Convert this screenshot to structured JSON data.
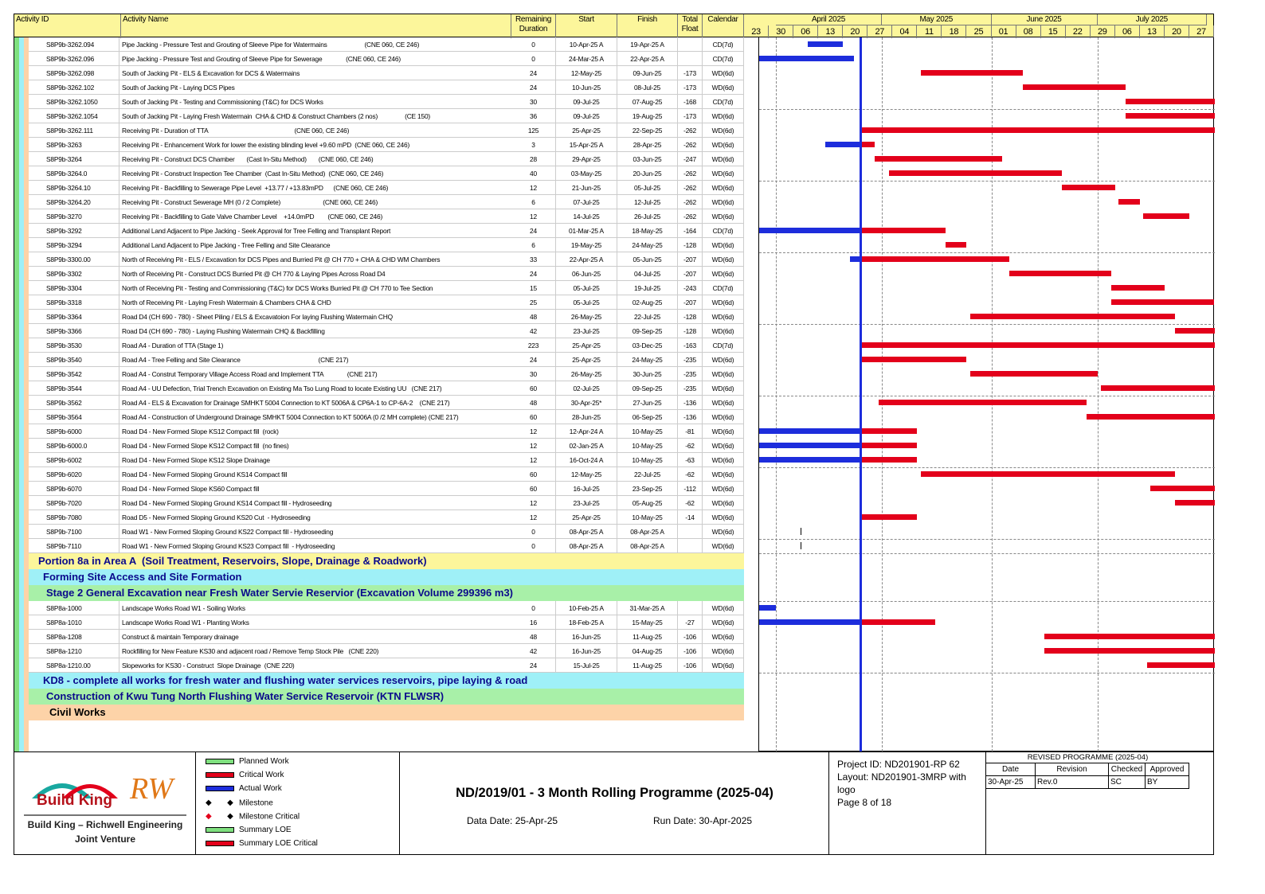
{
  "colors": {
    "planned": "#7fe07f",
    "critical": "#e3001b",
    "actual": "#1d2ddc",
    "header": "#fcf69b"
  },
  "columns": {
    "id": "Activity ID",
    "name": "Activity Name",
    "dur": "Remaining Duration",
    "start": "Start",
    "finish": "Finish",
    "float": "Total Float",
    "cal": "Calendar"
  },
  "timeline": {
    "months": [
      "April 2025",
      "May 2025",
      "June 2025",
      "July 2025"
    ],
    "weeks": [
      "23",
      "30",
      "06",
      "13",
      "20",
      "27",
      "04",
      "11",
      "18",
      "25",
      "01",
      "08",
      "15",
      "22",
      "29",
      "06",
      "13",
      "20",
      "27"
    ],
    "data_date_label": "Data Date"
  },
  "rows": [
    {
      "id": "S8P9b-3262.094",
      "name": "Pipe Jacking - Pressure Test and Grouting of Sleeve Pipe for Watermains                      (CNE 060, CE 246)",
      "dur": "0",
      "start": "10-Apr-25 A",
      "finish": "19-Apr-25 A",
      "float": "",
      "cal": "CD(7d)",
      "bars": [
        {
          "t": "actual",
          "s": "2025-04-10",
          "f": "2025-04-19"
        }
      ]
    },
    {
      "id": "S8P9b-3262.096",
      "name": "Pipe Jacking - Pressure Test and Grouting of Sleeve Pipe for Sewerage              (CNE 060, CE 246)",
      "dur": "0",
      "start": "24-Mar-25 A",
      "finish": "22-Apr-25 A",
      "float": "",
      "cal": "CD(7d)",
      "bars": [
        {
          "t": "actual",
          "s": "2025-03-24",
          "f": "2025-04-22"
        }
      ]
    },
    {
      "id": "S8P9b-3262.098",
      "name": "South of Jacking Pit - ELS & Excavation for DCS & Watermains",
      "dur": "24",
      "start": "12-May-25",
      "finish": "09-Jun-25",
      "float": "-173",
      "cal": "WD(6d)",
      "bars": [
        {
          "t": "critical",
          "s": "2025-05-12",
          "f": "2025-06-09"
        }
      ]
    },
    {
      "id": "S8P9b-3262.102",
      "name": "South of Jacking Pit - Laying DCS Pipes",
      "dur": "24",
      "start": "10-Jun-25",
      "finish": "08-Jul-25",
      "float": "-173",
      "cal": "WD(6d)",
      "bars": [
        {
          "t": "critical",
          "s": "2025-06-10",
          "f": "2025-07-08"
        }
      ]
    },
    {
      "id": "S8P9b-3262.1050",
      "name": "South of Jacking Pit - Testing and Commissioning (T&C) for DCS Works",
      "dur": "30",
      "start": "09-Jul-25",
      "finish": "07-Aug-25",
      "float": "-168",
      "cal": "CD(7d)",
      "bars": [
        {
          "t": "critical",
          "s": "2025-07-09",
          "f": "2025-08-07"
        }
      ]
    },
    {
      "id": "S8P9b-3262.1054",
      "name": "South of Jacking Pit - Laying Fresh Watermain  CHA & CHD & Construct Chambers (2 nos)                (CE 150)",
      "dur": "36",
      "start": "09-Jul-25",
      "finish": "19-Aug-25",
      "float": "-173",
      "cal": "WD(6d)",
      "bars": [
        {
          "t": "critical",
          "s": "2025-07-09",
          "f": "2025-08-19"
        }
      ]
    },
    {
      "id": "S8P9b-3262.111",
      "name": "Receiving Pit - Duration of TTA                                                   (CNE 060, CE 246)",
      "dur": "125",
      "start": "25-Apr-25",
      "finish": "22-Sep-25",
      "float": "-262",
      "cal": "WD(6d)",
      "bars": [
        {
          "t": "critical",
          "s": "2025-04-25",
          "f": "2025-09-22"
        }
      ]
    },
    {
      "id": "S8P9b-3263",
      "name": "Receiving Pit - Enhancement Work for lower the existing blinding level +9.60 mPD  (CNE 060, CE 246)",
      "dur": "3",
      "start": "15-Apr-25 A",
      "finish": "28-Apr-25",
      "float": "-262",
      "cal": "WD(6d)",
      "bars": [
        {
          "t": "actual",
          "s": "2025-04-15",
          "f": "2025-04-25"
        },
        {
          "t": "critical",
          "s": "2025-04-25",
          "f": "2025-04-28"
        }
      ]
    },
    {
      "id": "S8P9b-3264",
      "name": "Receiving Pit - Construct DCS Chamber       (Cast In-Situ Method)       (CNE 060, CE 246)",
      "dur": "28",
      "start": "29-Apr-25",
      "finish": "03-Jun-25",
      "float": "-247",
      "cal": "WD(6d)",
      "bars": [
        {
          "t": "critical",
          "s": "2025-04-29",
          "f": "2025-06-03"
        }
      ]
    },
    {
      "id": "S8P9b-3264.0",
      "name": "Receiving Pit - Construct Inspection Tee Chamber  (Cast In-Situ Method)  (CNE 060, CE 246)",
      "dur": "40",
      "start": "03-May-25",
      "finish": "20-Jun-25",
      "float": "-262",
      "cal": "WD(6d)",
      "bars": [
        {
          "t": "critical",
          "s": "2025-05-03",
          "f": "2025-06-20"
        }
      ]
    },
    {
      "id": "S8P9b-3264.10",
      "name": "Receiving Pit - Backfilling to Sewerage Pipe Level  +13.77 / +13.83mPD      (CNE 060, CE 246)",
      "dur": "12",
      "start": "21-Jun-25",
      "finish": "05-Jul-25",
      "float": "-262",
      "cal": "WD(6d)",
      "bars": [
        {
          "t": "critical",
          "s": "2025-06-21",
          "f": "2025-07-05"
        }
      ]
    },
    {
      "id": "S8P9b-3264.20",
      "name": "Receiving Pit - Construct Sewerage MH (0 / 2 Complete)                         (CNE 060, CE 246)",
      "dur": "6",
      "start": "07-Jul-25",
      "finish": "12-Jul-25",
      "float": "-262",
      "cal": "WD(6d)",
      "bars": [
        {
          "t": "critical",
          "s": "2025-07-07",
          "f": "2025-07-12"
        }
      ]
    },
    {
      "id": "S8P9b-3270",
      "name": "Receiving Pit - Backfilling to Gate Valve Chamber Level    +14.0mPD        (CNE 060, CE 246)",
      "dur": "12",
      "start": "14-Jul-25",
      "finish": "26-Jul-25",
      "float": "-262",
      "cal": "WD(6d)",
      "bars": [
        {
          "t": "critical",
          "s": "2025-07-14",
          "f": "2025-07-26"
        }
      ]
    },
    {
      "id": "S8P9b-3292",
      "name": "Additional Land Adjacent to Pipe Jacking - Seek Approval for Tree Felling and Transplant Report",
      "dur": "24",
      "start": "01-Mar-25 A",
      "finish": "18-May-25",
      "float": "-164",
      "cal": "CD(7d)",
      "bars": [
        {
          "t": "actual",
          "s": "2025-03-01",
          "f": "2025-04-25"
        },
        {
          "t": "critical",
          "s": "2025-04-25",
          "f": "2025-05-18"
        }
      ]
    },
    {
      "id": "S8P9b-3294",
      "name": "Additional Land Adjacent to Pipe Jacking - Tree Felling and Site Clearance",
      "dur": "6",
      "start": "19-May-25",
      "finish": "24-May-25",
      "float": "-128",
      "cal": "WD(6d)",
      "bars": [
        {
          "t": "critical",
          "s": "2025-05-19",
          "f": "2025-05-24"
        }
      ]
    },
    {
      "id": "S8P9b-3300.00",
      "name": "North of Receiving Pit - ELS / Excavation for DCS Pipes and Burried Pit @ CH 770 + CHA & CHD WM Chambers",
      "dur": "33",
      "start": "22-Apr-25 A",
      "finish": "05-Jun-25",
      "float": "-207",
      "cal": "WD(6d)",
      "bars": [
        {
          "t": "actual",
          "s": "2025-04-22",
          "f": "2025-04-25"
        },
        {
          "t": "critical",
          "s": "2025-04-25",
          "f": "2025-06-05"
        }
      ]
    },
    {
      "id": "S8P9b-3302",
      "name": "North of Receiving Pit - Construct DCS Burried Pit @ CH 770 & Laying Pipes Across Road D4",
      "dur": "24",
      "start": "06-Jun-25",
      "finish": "04-Jul-25",
      "float": "-207",
      "cal": "WD(6d)",
      "bars": [
        {
          "t": "critical",
          "s": "2025-06-06",
          "f": "2025-07-04"
        }
      ]
    },
    {
      "id": "S8P9b-3304",
      "name": "North of Receiving Pit - Testing and Commissioning (T&C) for DCS Works Burried Pit @ CH 770 to Tee Section",
      "dur": "15",
      "start": "05-Jul-25",
      "finish": "19-Jul-25",
      "float": "-243",
      "cal": "CD(7d)",
      "bars": [
        {
          "t": "critical",
          "s": "2025-07-05",
          "f": "2025-07-19"
        }
      ]
    },
    {
      "id": "S8P9b-3318",
      "name": "North of Receiving Pit - Laying Fresh Watermain & Chambers CHA & CHD",
      "dur": "25",
      "start": "05-Jul-25",
      "finish": "02-Aug-25",
      "float": "-207",
      "cal": "WD(6d)",
      "bars": [
        {
          "t": "critical",
          "s": "2025-07-05",
          "f": "2025-08-02"
        }
      ]
    },
    {
      "id": "S8P9b-3364",
      "name": "Road D4 (CH 690 - 780) - Sheet Piling / ELS & Excavatoion For laying Flushing Watermain CHQ",
      "dur": "48",
      "start": "26-May-25",
      "finish": "22-Jul-25",
      "float": "-128",
      "cal": "WD(6d)",
      "bars": [
        {
          "t": "critical",
          "s": "2025-05-26",
          "f": "2025-07-22"
        }
      ]
    },
    {
      "id": "S8P9b-3366",
      "name": "Road D4 (CH 690 - 780) - Laying Flushing Watermain CHQ & Backfilling",
      "dur": "42",
      "start": "23-Jul-25",
      "finish": "09-Sep-25",
      "float": "-128",
      "cal": "WD(6d)",
      "bars": [
        {
          "t": "critical",
          "s": "2025-07-23",
          "f": "2025-09-09"
        }
      ]
    },
    {
      "id": "S8P9b-3530",
      "name": "Road A4 - Duration of TTA (Stage 1)",
      "dur": "223",
      "start": "25-Apr-25",
      "finish": "03-Dec-25",
      "float": "-163",
      "cal": "CD(7d)",
      "bars": [
        {
          "t": "critical",
          "s": "2025-04-25",
          "f": "2025-12-03"
        }
      ]
    },
    {
      "id": "S8P9b-3540",
      "name": "Road A4 - Tree Felling and Site Clearance                                              (CNE 217)",
      "dur": "24",
      "start": "25-Apr-25",
      "finish": "24-May-25",
      "float": "-235",
      "cal": "WD(6d)",
      "bars": [
        {
          "t": "critical",
          "s": "2025-04-25",
          "f": "2025-05-24"
        }
      ]
    },
    {
      "id": "S8P9b-3542",
      "name": "Road A4 - Construt Temporary Village Access Road and Implement TTA              (CNE 217)",
      "dur": "30",
      "start": "26-May-25",
      "finish": "30-Jun-25",
      "float": "-235",
      "cal": "WD(6d)",
      "bars": [
        {
          "t": "critical",
          "s": "2025-05-26",
          "f": "2025-06-30"
        }
      ]
    },
    {
      "id": "S8P9b-3544",
      "name": "Road A4 - UU Defection, Trial Trench Excavation on Existing Ma Tso Lung Road to locate Existing UU   (CNE 217)",
      "dur": "60",
      "start": "02-Jul-25",
      "finish": "09-Sep-25",
      "float": "-235",
      "cal": "WD(6d)",
      "bars": [
        {
          "t": "critical",
          "s": "2025-07-02",
          "f": "2025-09-09"
        }
      ]
    },
    {
      "id": "S8P9b-3562",
      "name": "Road A4 - ELS & Excavation for Drainage SMHKT 5004 Connection to KT 5006A & CP6A-1 to CP-6A-2    (CNE 217)",
      "dur": "48",
      "start": "30-Apr-25*",
      "finish": "27-Jun-25",
      "float": "-136",
      "cal": "WD(6d)",
      "bars": [
        {
          "t": "critical",
          "s": "2025-04-30",
          "f": "2025-06-27"
        }
      ]
    },
    {
      "id": "S8P9b-3564",
      "name": "Road A4 - Construction of Underground Drainage SMHKT 5004 Connection to KT 5006A (0 /2 MH complete) (CNE 217)",
      "dur": "60",
      "start": "28-Jun-25",
      "finish": "06-Sep-25",
      "float": "-136",
      "cal": "WD(6d)",
      "bars": [
        {
          "t": "critical",
          "s": "2025-06-28",
          "f": "2025-09-06"
        }
      ]
    },
    {
      "id": "S8P9b-6000",
      "name": "Road D4 - New Formed Slope KS12 Compact fill  (rock)",
      "dur": "12",
      "start": "12-Apr-24 A",
      "finish": "10-May-25",
      "float": "-81",
      "cal": "WD(6d)",
      "bars": [
        {
          "t": "actual",
          "s": "2024-04-12",
          "f": "2025-04-25"
        },
        {
          "t": "critical",
          "s": "2025-04-25",
          "f": "2025-05-10"
        }
      ]
    },
    {
      "id": "S8P9b-6000.0",
      "name": "Road D4 - New Formed Slope KS12 Compact fill  (no fines)",
      "dur": "12",
      "start": "02-Jan-25 A",
      "finish": "10-May-25",
      "float": "-62",
      "cal": "WD(6d)",
      "bars": [
        {
          "t": "actual",
          "s": "2025-01-02",
          "f": "2025-04-25"
        },
        {
          "t": "critical",
          "s": "2025-04-25",
          "f": "2025-05-10"
        }
      ]
    },
    {
      "id": "S8P9b-6002",
      "name": "Road D4 - New Formed Slope KS12 Slope Drainage",
      "dur": "12",
      "start": "16-Oct-24 A",
      "finish": "10-May-25",
      "float": "-63",
      "cal": "WD(6d)",
      "bars": [
        {
          "t": "actual",
          "s": "2024-10-16",
          "f": "2025-04-25"
        },
        {
          "t": "critical",
          "s": "2025-04-25",
          "f": "2025-05-10"
        }
      ]
    },
    {
      "id": "S8P9b-6020",
      "name": "Road D4 - New Formed Sloping Ground KS14 Compact fill",
      "dur": "60",
      "start": "12-May-25",
      "finish": "22-Jul-25",
      "float": "-62",
      "cal": "WD(6d)",
      "bars": [
        {
          "t": "critical",
          "s": "2025-05-12",
          "f": "2025-07-22"
        }
      ]
    },
    {
      "id": "S8P9b-6070",
      "name": "Road D4 - New Formed Slope KS60 Compact fill",
      "dur": "60",
      "start": "16-Jul-25",
      "finish": "23-Sep-25",
      "float": "-112",
      "cal": "WD(6d)",
      "bars": [
        {
          "t": "critical",
          "s": "2025-07-16",
          "f": "2025-09-23"
        }
      ]
    },
    {
      "id": "S8P9b-7020",
      "name": "Road D4 - New Formed Sloping Ground KS14 Compact fill - Hydroseeding",
      "dur": "12",
      "start": "23-Jul-25",
      "finish": "05-Aug-25",
      "float": "-62",
      "cal": "WD(6d)",
      "bars": [
        {
          "t": "critical",
          "s": "2025-07-23",
          "f": "2025-08-05"
        }
      ]
    },
    {
      "id": "S8P9b-7080",
      "name": "Road D5 - New Formed Sloping Ground KS20 Cut  - Hydroseeding",
      "dur": "12",
      "start": "25-Apr-25",
      "finish": "10-May-25",
      "float": "-14",
      "cal": "WD(6d)",
      "bars": [
        {
          "t": "critical",
          "s": "2025-04-25",
          "f": "2025-05-10"
        }
      ]
    },
    {
      "id": "S8P9b-7100",
      "name": "Road W1 - New Formed Sloping Ground KS22 Compact fill - Hydroseeding",
      "dur": "0",
      "start": "08-Apr-25 A",
      "finish": "08-Apr-25 A",
      "float": "",
      "cal": "WD(6d)",
      "bars": [
        {
          "t": "tick",
          "s": "2025-04-08",
          "f": "2025-04-08"
        }
      ]
    },
    {
      "id": "S8P9b-7110",
      "name": "Road W1 - New Formed Sloping Ground KS23 Compact fill  - Hydroseeding",
      "dur": "0",
      "start": "08-Apr-25 A",
      "finish": "08-Apr-25 A",
      "float": "",
      "cal": "WD(6d)",
      "bars": [
        {
          "t": "tick",
          "s": "2025-04-08",
          "f": "2025-04-08"
        }
      ]
    }
  ],
  "bands": [
    {
      "text": "Portion 8a in Area A  (Soil Treatment, Reservoirs, Slope, Drainage & Roadwork)",
      "bg": "#fcf69b",
      "color": "#0a0a8c",
      "indent": 30
    },
    {
      "text": "Forming Site Access and Site Formation",
      "bg": "#9ff0f7",
      "color": "#0a0a8c",
      "indent": 36
    },
    {
      "text": "Stage 2 General Excavation near Fresh Water Servie Reservior (Excavation Volume 299396 m3)",
      "bg": "#a8f0a8",
      "color": "#0a0a8c",
      "indent": 40
    }
  ],
  "rows2": [
    {
      "id": "S8P8a-1000",
      "name": "Landscape Works Road W1 - Soiling Works",
      "dur": "0",
      "start": "10-Feb-25 A",
      "finish": "31-Mar-25 A",
      "float": "",
      "cal": "WD(6d)",
      "bars": [
        {
          "t": "actual",
          "s": "2025-02-10",
          "f": "2025-03-31"
        }
      ]
    },
    {
      "id": "S8P8a-1010",
      "name": "Landscape Works Road W1 - Planting Works",
      "dur": "16",
      "start": "18-Feb-25 A",
      "finish": "15-May-25",
      "float": "-27",
      "cal": "WD(6d)",
      "bars": [
        {
          "t": "actual",
          "s": "2025-02-18",
          "f": "2025-04-25"
        },
        {
          "t": "critical",
          "s": "2025-04-25",
          "f": "2025-05-15"
        }
      ]
    },
    {
      "id": "S8P8a-1208",
      "name": "Construct & maintain Temporary drainage",
      "dur": "48",
      "start": "16-Jun-25",
      "finish": "11-Aug-25",
      "float": "-106",
      "cal": "WD(6d)",
      "bars": [
        {
          "t": "critical",
          "s": "2025-06-16",
          "f": "2025-08-11"
        }
      ]
    },
    {
      "id": "S8P8a-1210",
      "name": "Rockfilling for New Feature KS30 and adjacent road / Remove Temp Stock Pile   (CNE 220)",
      "dur": "42",
      "start": "16-Jun-25",
      "finish": "04-Aug-25",
      "float": "-106",
      "cal": "WD(6d)",
      "bars": [
        {
          "t": "critical",
          "s": "2025-06-16",
          "f": "2025-08-04"
        }
      ]
    },
    {
      "id": "S8P8a-1210.00",
      "name": "Slopeworks for KS30 - Construct  Slope Drainage  (CNE 220)",
      "dur": "24",
      "start": "15-Jul-25",
      "finish": "11-Aug-25",
      "float": "-106",
      "cal": "WD(6d)",
      "bars": [
        {
          "t": "critical",
          "s": "2025-07-15",
          "f": "2025-08-11"
        }
      ]
    }
  ],
  "bands2": [
    {
      "text": "KD8 - complete all works for fresh water and flushing water services reservoirs, pipe laying & road",
      "bg": "#9ff0f7",
      "color": "#0a0a8c",
      "indent": 36
    },
    {
      "text": "Construction of Kwu Tung North Flushing Water Service Reservoir (KTN FLWSR)",
      "bg": "#a8f0a8",
      "color": "#0a0a8c",
      "indent": 40
    },
    {
      "text": "Civil Works",
      "bg": "#fdd3a8",
      "color": "#000000",
      "indent": 44
    }
  ],
  "legend": [
    {
      "label": "Planned Work",
      "kind": "bar",
      "color": "#7fe07f"
    },
    {
      "label": "Critical Work",
      "kind": "bar",
      "color": "#e3001b"
    },
    {
      "label": "Actual Work",
      "kind": "bar",
      "color": "#1d2ddc"
    },
    {
      "label": "Milestone",
      "kind": "ms",
      "color": "#000000"
    },
    {
      "label": "Milestone Critical",
      "kind": "ms",
      "color": "#e3001b"
    },
    {
      "label": "Summary LOE",
      "kind": "bar",
      "color": "#7fe07f"
    },
    {
      "label": "Summary LOE Critical",
      "kind": "bar",
      "color": "#e3001b"
    }
  ],
  "footer": {
    "logo_brand": "Build King",
    "logo_rw": "RW",
    "logo_caption1": "Build King – Richwell Engineering",
    "logo_caption2": "Joint Venture",
    "title": "ND/2019/01 - 3 Month Rolling Programme (2025-04)",
    "data_date": "Data Date: 25-Apr-25",
    "run_date": "Run Date: 30-Apr-2025",
    "project_id": "Project ID: ND201901-RP 62",
    "layout": "Layout: ND201901-3MRP with logo",
    "page": "Page 8 of 18",
    "rev_title": "REVISED PROGRAMME (2025-04)",
    "rev_headers": [
      "Date",
      "Revision",
      "Checked",
      "Approved"
    ],
    "rev_values": [
      "30-Apr-25",
      "Rev.0",
      "SC",
      "BY"
    ]
  }
}
